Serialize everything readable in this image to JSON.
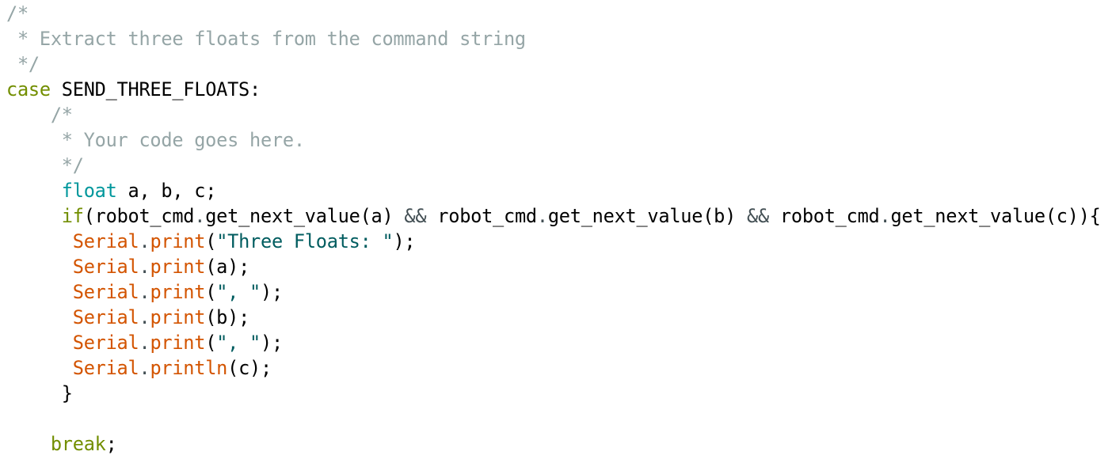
{
  "colors": {
    "comment": "#95a5a6",
    "keyword": "#728e00",
    "type": "#00979c",
    "function": "#d35400",
    "string": "#005c5f",
    "operator": "#434f54"
  },
  "lines": [
    [
      [
        "/*",
        "cm"
      ]
    ],
    [
      [
        " * Extract three floats from the command string",
        "cm"
      ]
    ],
    [
      [
        " */",
        "cm"
      ]
    ],
    [
      [
        "case",
        "kw"
      ],
      [
        " SEND_THREE_FLOATS:",
        "tx"
      ]
    ],
    [
      [
        "    /*",
        "cm"
      ]
    ],
    [
      [
        "     * Your code goes here.",
        "cm"
      ]
    ],
    [
      [
        "     */",
        "cm"
      ]
    ],
    [
      [
        "     ",
        "tx"
      ],
      [
        "float",
        "ty"
      ],
      [
        " a, b, c;",
        "tx"
      ]
    ],
    [
      [
        "     ",
        "tx"
      ],
      [
        "if",
        "kw"
      ],
      [
        "(robot_cmd",
        "tx"
      ],
      [
        ".",
        "op"
      ],
      [
        "get_next_value(a) ",
        "tx"
      ],
      [
        "&&",
        "op"
      ],
      [
        " robot_cmd",
        "tx"
      ],
      [
        ".",
        "op"
      ],
      [
        "get_next_value(b) ",
        "tx"
      ],
      [
        "&&",
        "op"
      ],
      [
        " robot_cmd",
        "tx"
      ],
      [
        ".",
        "op"
      ],
      [
        "get_next_value(c)){",
        "tx"
      ]
    ],
    [
      [
        "      ",
        "tx"
      ],
      [
        "Serial",
        "fn"
      ],
      [
        ".",
        "op"
      ],
      [
        "print",
        "fn"
      ],
      [
        "(",
        "tx"
      ],
      [
        "\"Three Floats: \"",
        "st"
      ],
      [
        ");",
        "tx"
      ]
    ],
    [
      [
        "      ",
        "tx"
      ],
      [
        "Serial",
        "fn"
      ],
      [
        ".",
        "op"
      ],
      [
        "print",
        "fn"
      ],
      [
        "(a);",
        "tx"
      ]
    ],
    [
      [
        "      ",
        "tx"
      ],
      [
        "Serial",
        "fn"
      ],
      [
        ".",
        "op"
      ],
      [
        "print",
        "fn"
      ],
      [
        "(",
        "tx"
      ],
      [
        "\", \"",
        "st"
      ],
      [
        ");",
        "tx"
      ]
    ],
    [
      [
        "      ",
        "tx"
      ],
      [
        "Serial",
        "fn"
      ],
      [
        ".",
        "op"
      ],
      [
        "print",
        "fn"
      ],
      [
        "(b);",
        "tx"
      ]
    ],
    [
      [
        "      ",
        "tx"
      ],
      [
        "Serial",
        "fn"
      ],
      [
        ".",
        "op"
      ],
      [
        "print",
        "fn"
      ],
      [
        "(",
        "tx"
      ],
      [
        "\", \"",
        "st"
      ],
      [
        ");",
        "tx"
      ]
    ],
    [
      [
        "      ",
        "tx"
      ],
      [
        "Serial",
        "fn"
      ],
      [
        ".",
        "op"
      ],
      [
        "println",
        "fn"
      ],
      [
        "(c);",
        "tx"
      ]
    ],
    [
      [
        "     }",
        "tx"
      ]
    ],
    [],
    [
      [
        "    ",
        "tx"
      ],
      [
        "break",
        "kw"
      ],
      [
        ";",
        "tx"
      ]
    ]
  ]
}
